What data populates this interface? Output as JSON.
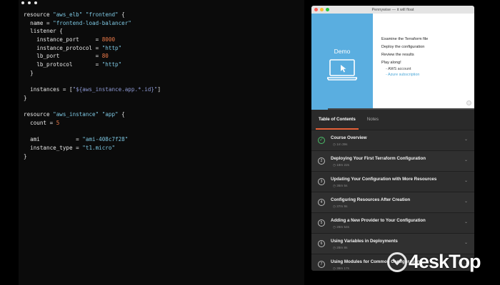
{
  "editor": {
    "lines": [
      [
        {
          "t": "resource ",
          "c": "kw"
        },
        {
          "t": "\"aws_elb\"",
          "c": "str"
        },
        {
          "t": " ",
          "c": "kw"
        },
        {
          "t": "\"frontend\"",
          "c": "str"
        },
        {
          "t": " {",
          "c": "kw"
        }
      ],
      [
        {
          "t": "  name = ",
          "c": "kw"
        },
        {
          "t": "\"frontend-load-balancer\"",
          "c": "str"
        }
      ],
      [
        {
          "t": "  listener {",
          "c": "kw"
        }
      ],
      [
        {
          "t": "    instance_port     = ",
          "c": "kw"
        },
        {
          "t": "8000",
          "c": "num"
        }
      ],
      [
        {
          "t": "    instance_protocol = ",
          "c": "kw"
        },
        {
          "t": "\"http\"",
          "c": "str"
        }
      ],
      [
        {
          "t": "    lb_port           = ",
          "c": "kw"
        },
        {
          "t": "80",
          "c": "num"
        }
      ],
      [
        {
          "t": "    lb_protocol       = ",
          "c": "kw"
        },
        {
          "t": "\"http\"",
          "c": "str"
        }
      ],
      [
        {
          "t": "  }",
          "c": "kw"
        }
      ],
      [
        {
          "t": "",
          "c": "kw"
        }
      ],
      [
        {
          "t": "  instances = [",
          "c": "kw"
        },
        {
          "t": "\"${aws_instance.app.*.id}\"",
          "c": "interp"
        },
        {
          "t": "]",
          "c": "kw"
        }
      ],
      [
        {
          "t": "}",
          "c": "kw"
        }
      ],
      [
        {
          "t": "",
          "c": "kw"
        }
      ],
      [
        {
          "t": "resource ",
          "c": "kw"
        },
        {
          "t": "\"aws_instance\"",
          "c": "str"
        },
        {
          "t": " ",
          "c": "kw"
        },
        {
          "t": "\"app\"",
          "c": "str"
        },
        {
          "t": " {",
          "c": "kw"
        }
      ],
      [
        {
          "t": "  count = ",
          "c": "kw"
        },
        {
          "t": "5",
          "c": "num"
        }
      ],
      [
        {
          "t": "",
          "c": "kw"
        }
      ],
      [
        {
          "t": "  ami           = ",
          "c": "kw"
        },
        {
          "t": "\"ami-408c7f28\"",
          "c": "str"
        }
      ],
      [
        {
          "t": "  instance_type = ",
          "c": "kw"
        },
        {
          "t": "\"t1.micro\"",
          "c": "str"
        }
      ],
      [
        {
          "t": "}",
          "c": "kw"
        }
      ]
    ]
  },
  "window": {
    "title": "Pennywise — it will float",
    "lights": [
      "#ff5f57",
      "#febc2e",
      "#28c840"
    ]
  },
  "video": {
    "demo_label": "Demo",
    "items": [
      "Examine the Terraform file",
      "Deploy the configuration",
      "Review the results",
      "Play along!"
    ],
    "sub_items": [
      {
        "text": "- AWS account",
        "style": "dark"
      },
      {
        "text": "- Azure subscription",
        "style": "link"
      }
    ],
    "progress": 0.1
  },
  "tabs": [
    "Table of Contents",
    "Notes"
  ],
  "modules": [
    {
      "title": "Course Overview",
      "duration": "1m 39s",
      "icon": "✓",
      "done": true
    },
    {
      "title": "Deploying Your First Terraform Configuration",
      "duration": "18m 22s",
      "icon": "2",
      "done": false
    },
    {
      "title": "Updating Your Configuration with More Resources",
      "duration": "36m 5s",
      "icon": "3",
      "done": false
    },
    {
      "title": "Configuring Resources After Creation",
      "duration": "37m 9s",
      "icon": "4",
      "done": false
    },
    {
      "title": "Adding a New Provider to Your Configuration",
      "duration": "28m 54s",
      "icon": "5",
      "done": false
    },
    {
      "title": "Using Variables in Deployments",
      "duration": "28m 8s",
      "icon": "6",
      "done": false
    },
    {
      "title": "Using Modules for Common Configurations",
      "duration": "38m 17s",
      "icon": "7",
      "done": false
    }
  ],
  "watermark": {
    "text": "4eskTop"
  }
}
